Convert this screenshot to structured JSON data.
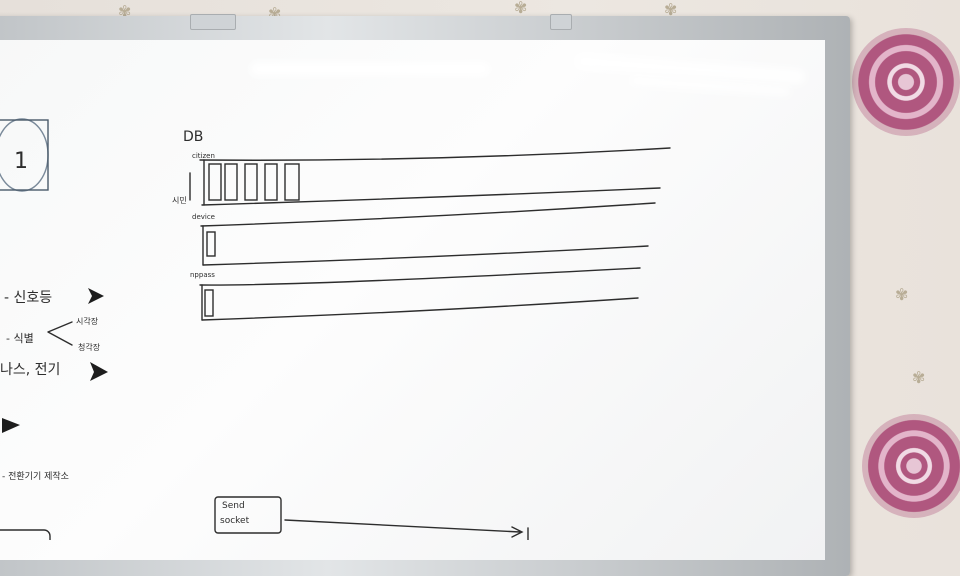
{
  "whiteboard": {
    "title": "DB",
    "tables": [
      {
        "label": "citizen",
        "slot_count": 6
      },
      {
        "label": "device",
        "slot_count": 1
      },
      {
        "label": "nppass",
        "slot_count": 1
      }
    ],
    "side_label": "시민",
    "left_notes": [
      "- 신호등",
      "- 식별",
      "시각장",
      "청각장",
      "나스, 전기",
      "- 전환기기 제작소"
    ],
    "send_box": {
      "line1": "Send",
      "line2": "socket"
    },
    "left_box_mark": "1"
  },
  "colors": {
    "wall": "#e9e3dd",
    "board": "#f7f8f8",
    "frame": "#c4c8cb",
    "marker": "#2d2d2d",
    "flower": "#b0577f"
  }
}
